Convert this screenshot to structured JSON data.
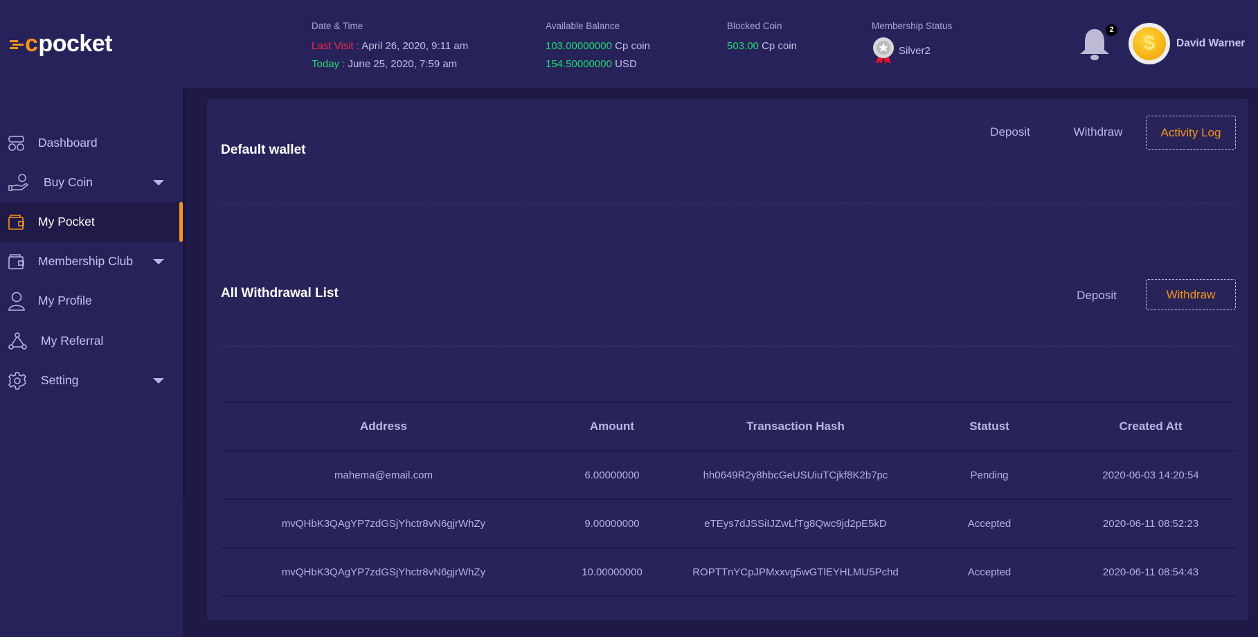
{
  "header": {
    "logo_text": "pocket",
    "logo_mark": "c",
    "date_time": {
      "label": "Date & Time",
      "last_visit_label": "Last Visit :",
      "last_visit": "April 26, 2020, 9:11 am",
      "today_label": "Today :",
      "today": "June 25, 2020, 7:59 am"
    },
    "balance": {
      "label": "Available Balance",
      "coin_value": "103.00000000",
      "coin_unit": "Cp coin",
      "usd_value": "154.50000000",
      "usd_unit": "USD"
    },
    "blocked": {
      "label": "Blocked Coin",
      "value": "503.00",
      "unit": "Cp coin"
    },
    "membership": {
      "label": "Membership Status",
      "value": "Silver2"
    },
    "notifications": {
      "count": "2"
    },
    "user": {
      "name": "David Warner",
      "avatar_symbol": "$"
    }
  },
  "sidebar": {
    "items": [
      {
        "label": "Dashboard"
      },
      {
        "label": "Buy Coin"
      },
      {
        "label": "My Pocket"
      },
      {
        "label": "Membership Club"
      },
      {
        "label": "My Profile"
      },
      {
        "label": "My Referral"
      },
      {
        "label": "Setting"
      }
    ]
  },
  "wallet": {
    "title": "Default wallet",
    "tabs": [
      "Deposit",
      "Withdraw",
      "Activity Log"
    ],
    "active_tab": "Activity Log"
  },
  "withdrawals": {
    "title": "All Withdrawal List",
    "tabs": [
      "Deposit",
      "Withdraw"
    ],
    "active_tab": "Withdraw",
    "columns": [
      "Address",
      "Amount",
      "Transaction Hash",
      "Statust",
      "Created Att"
    ],
    "rows": [
      [
        "mahema@email.com",
        "6.00000000",
        "hh0649R2y8hbcGeUSUiuTCjkf8K2b7pc",
        "Pending",
        "2020-06-03 14:20:54"
      ],
      [
        "mvQHbK3QAgYP7zdGSjYhctr8vN6gjrWhZy",
        "9.00000000",
        "eTEys7dJSSiIJZwLfTg8Qwc9jd2pE5kD",
        "Accepted",
        "2020-06-11 08:52:23"
      ],
      [
        "mvQHbK3QAgYP7zdGSjYhctr8vN6gjrWhZy",
        "10.00000000",
        "ROPTTnYCpJPMxxvg5wGTlEYHLMU5Pchd",
        "Accepted",
        "2020-06-11 08:54:43"
      ]
    ]
  },
  "colors": {
    "accent": "#f7931a",
    "positive": "#1fd971",
    "negative": "#f0294f"
  }
}
